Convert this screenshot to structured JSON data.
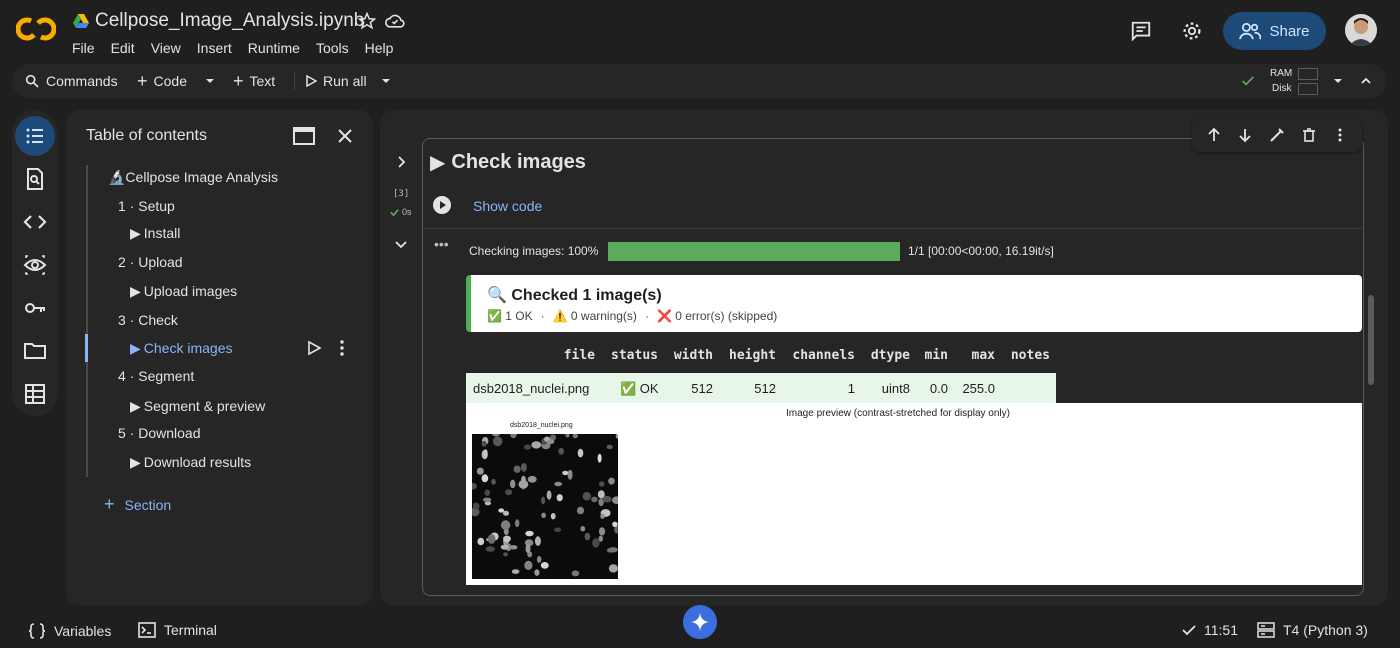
{
  "app": {
    "title": "Cellpose_Image_Analysis.ipynb",
    "menu": [
      "File",
      "Edit",
      "View",
      "Insert",
      "Runtime",
      "Tools",
      "Help"
    ],
    "share_label": "Share"
  },
  "toolbar": {
    "commands": "Commands",
    "code": "Code",
    "text": "Text",
    "run_all": "Run all",
    "ram": "RAM",
    "disk": "Disk"
  },
  "toc": {
    "title": "Table of contents",
    "items": [
      {
        "label": "🔬Cellpose Image Analysis"
      },
      {
        "label": "1 · Setup"
      },
      {
        "label": "Install"
      },
      {
        "label": "2 · Upload"
      },
      {
        "label": "Upload images"
      },
      {
        "label": "3 · Check"
      },
      {
        "label": "Check images"
      },
      {
        "label": "4 · Segment"
      },
      {
        "label": "Segment & preview"
      },
      {
        "label": "5 · Download"
      },
      {
        "label": "Download results"
      }
    ],
    "add_section": "Section"
  },
  "cell": {
    "heading": "Check images",
    "exec_count": "[3]",
    "exec_time": "0s",
    "show_code": "Show code",
    "progress_label": "Checking images: 100%",
    "progress_value": 1.0,
    "progress_stats": "1/1 [00:00<00:00, 16.19it/s]",
    "result_title": "🔍 Checked 1 image(s)",
    "ok": "✅ 1 OK",
    "warnings": "⚠️ 0 warning(s)",
    "errors": "❌ 0 error(s) (skipped)",
    "dot": "·",
    "table": {
      "headers": [
        "file",
        "status",
        "width",
        "height",
        "channels",
        "dtype",
        "min",
        "max",
        "notes"
      ],
      "row": [
        "dsb2018_nuclei.png",
        "✅ OK",
        "512",
        "512",
        "1",
        "uint8",
        "0.0",
        "255.0",
        ""
      ]
    },
    "preview_caption": "Image preview (contrast-stretched for display only)",
    "thumb_title": "dsb2018_nuclei.png"
  },
  "status_bar": {
    "variables": "Variables",
    "terminal": "Terminal",
    "time": "11:51",
    "runtime": "T4 (Python 3)"
  },
  "colors": {
    "accent": "#8ab4f8",
    "progress": "#5caa5c",
    "share_bg": "#1e4a7a"
  }
}
